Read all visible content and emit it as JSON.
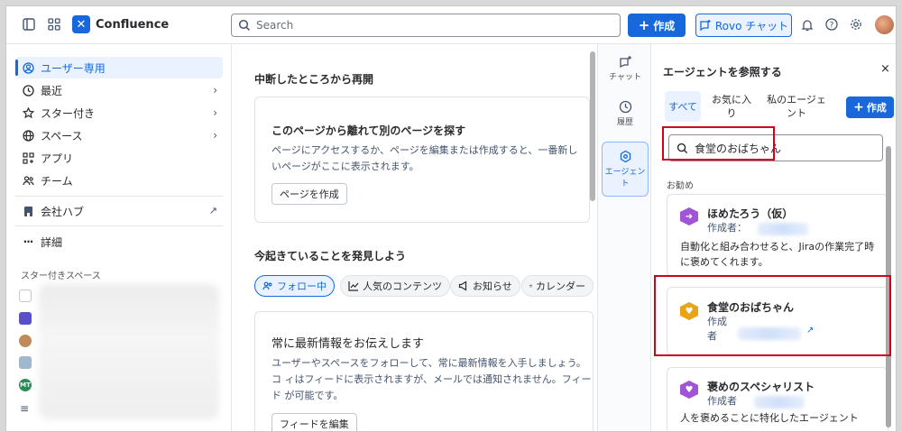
{
  "app": {
    "name": "Confluence"
  },
  "topbar": {
    "search_placeholder": "Search",
    "create_label": "作成",
    "rovo_label": "Rovo チャット"
  },
  "sidebar": {
    "items": [
      {
        "label": "ユーザー専用",
        "icon": "user-circle-icon"
      },
      {
        "label": "最近",
        "icon": "clock-icon"
      },
      {
        "label": "スター付き",
        "icon": "star-icon"
      },
      {
        "label": "スペース",
        "icon": "globe-icon"
      },
      {
        "label": "アプリ",
        "icon": "apps-icon"
      },
      {
        "label": "チーム",
        "icon": "team-icon"
      }
    ],
    "company_hub": "会社ハブ",
    "more": "詳細",
    "starred_spaces_title": "スター付きスペース",
    "space_badge": "MT"
  },
  "main": {
    "resume_title": "中断したところから再開",
    "find_card": {
      "title": "このページから離れて別のページを探す",
      "body": "ページにアクセスするか、ページを編集または作成すると、一番新しいページがここに表示されます。",
      "button": "ページを作成"
    },
    "discover_title": "今起きていることを発見しよう",
    "chips": [
      "フォロー中",
      "人気のコンテンツ",
      "お知らせ",
      "カレンダー"
    ],
    "updates_card": {
      "title": "常に最新情報をお伝えします",
      "body": "ユーザーやスペースをフォローして、常に最新情報を入手しましょう。コ ィはフィードに表示されますが、メールでは通知されません。フィード が可能です。",
      "button": "フィードを編集"
    }
  },
  "rail": {
    "items": [
      {
        "label": "チャット",
        "icon": "chat-sparkle-icon"
      },
      {
        "label": "履歴",
        "icon": "history-icon"
      },
      {
        "label": "エージェント",
        "icon": "agent-icon"
      }
    ]
  },
  "agent_panel": {
    "title": "エージェントを参照する",
    "close": "×",
    "tabs": [
      "すべて",
      "お気に入り",
      "私のエージェント"
    ],
    "create_label": "作成",
    "search_value": "食堂のおばちゃん",
    "recommended_label": "お勧め",
    "agents": [
      {
        "name": "ほめたろう（仮）",
        "by": "作成者：",
        "description": "自動化と組み合わせると、Jiraの作業完了時に褒めてくれます。",
        "color": "#a054d6"
      },
      {
        "name": "食堂のおばちゃん",
        "by": "作成者",
        "description": "",
        "color": "#e8a317"
      },
      {
        "name": "褒めのスペシャリスト",
        "by": "作成者",
        "description": "人を褒めることに特化したエージェント",
        "color": "#a054d6"
      }
    ]
  },
  "colors": {
    "accent": "#1868db",
    "highlight": "#d0021b"
  }
}
